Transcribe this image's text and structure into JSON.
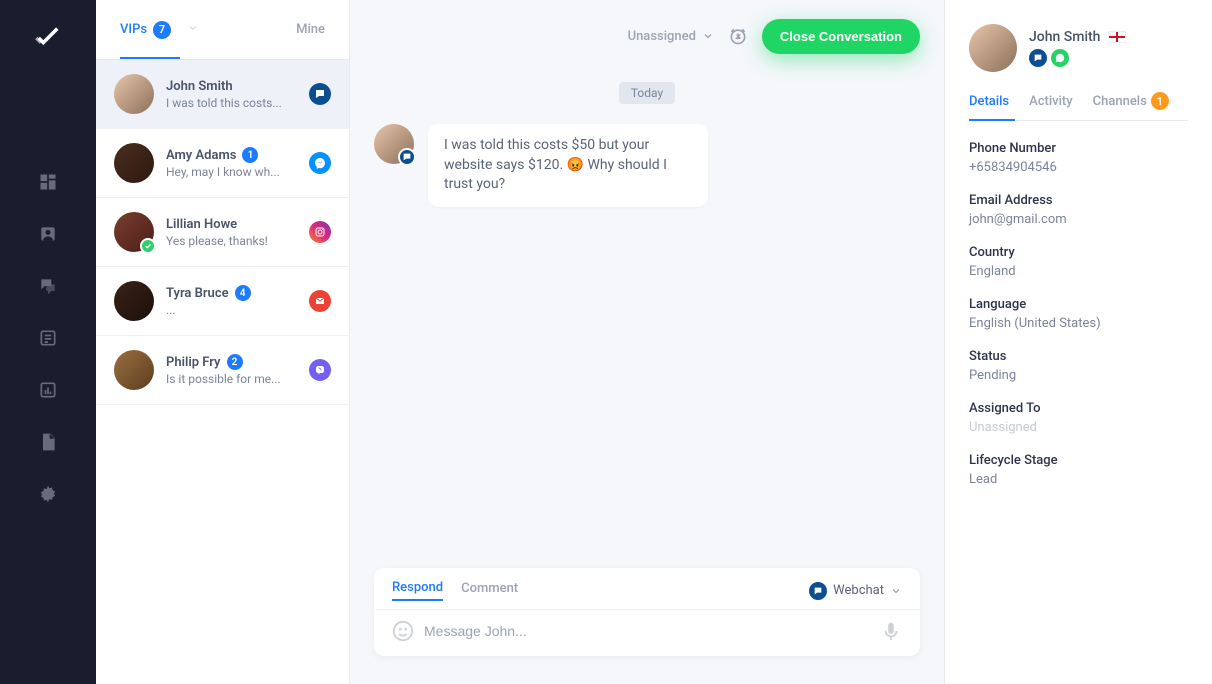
{
  "sidebar": {
    "icons": [
      "dashboard",
      "contacts",
      "messages",
      "list",
      "analytics",
      "document",
      "settings"
    ]
  },
  "tabs": {
    "vips": "VIPs",
    "vips_count": "7",
    "mine": "Mine"
  },
  "conversations": [
    {
      "name": "John Smith",
      "preview": "I was told this costs...",
      "channel": "webchat",
      "selected": true
    },
    {
      "name": "Amy Adams",
      "preview": "Hey, may I know wh...",
      "channel": "messenger",
      "badge": "1"
    },
    {
      "name": "Lillian Howe",
      "preview": "Yes please, thanks!",
      "channel": "instagram",
      "status": "green"
    },
    {
      "name": "Tyra Bruce",
      "preview": "...",
      "channel": "gmail",
      "badge": "4"
    },
    {
      "name": "Philip Fry",
      "preview": "Is it possible for me...",
      "channel": "viber",
      "badge": "2"
    }
  ],
  "chat": {
    "assigned": "Unassigned",
    "close_label": "Close Conversation",
    "date": "Today",
    "message": "I was told this costs $50 but your website says $120. 😡 Why should I trust you?"
  },
  "composer": {
    "respond": "Respond",
    "comment": "Comment",
    "channel": "Webchat",
    "placeholder": "Message John..."
  },
  "contact": {
    "name": "John Smith",
    "tabs": {
      "details": "Details",
      "activity": "Activity",
      "channels": "Channels",
      "channels_badge": "1"
    },
    "fields": {
      "phone_label": "Phone Number",
      "phone": "+65834904546",
      "email_label": "Email Address",
      "email": "john@gmail.com",
      "country_label": "Country",
      "country": "England",
      "language_label": "Language",
      "language": "English (United States)",
      "status_label": "Status",
      "status": "Pending",
      "assigned_label": "Assigned To",
      "assigned": "Unassigned",
      "lifecycle_label": "Lifecycle Stage",
      "lifecycle": "Lead"
    }
  }
}
